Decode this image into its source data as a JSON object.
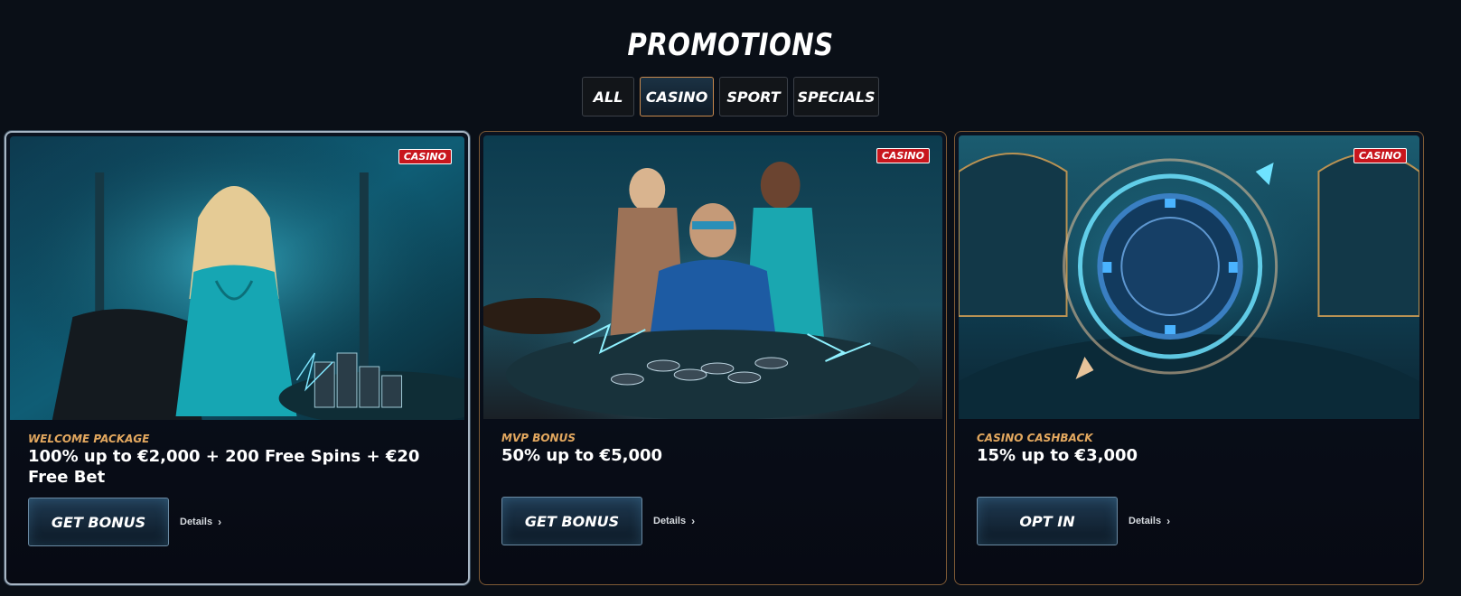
{
  "page": {
    "title": "PROMOTIONS"
  },
  "tabs": [
    {
      "label": "ALL",
      "active": false
    },
    {
      "label": "CASINO",
      "active": true
    },
    {
      "label": "SPORT",
      "active": false
    },
    {
      "label": "SPECIALS",
      "active": false
    }
  ],
  "cards": [
    {
      "badge": "CASINO",
      "kicker": "WELCOME PACKAGE",
      "offer": "100% up to €2,000 + 200 Free Spins + €20 Free Bet",
      "cta": "GET BONUS",
      "details": "Details",
      "image": "woman-at-casino-table-illustration"
    },
    {
      "badge": "CASINO",
      "kicker": "MVP BONUS",
      "offer": "50% up to €5,000",
      "cta": "GET BONUS",
      "details": "Details",
      "image": "vip-players-with-chips-illustration"
    },
    {
      "badge": "CASINO",
      "kicker": "CASINO CASHBACK",
      "offer": "15% up to €3,000",
      "cta": "OPT IN",
      "details": "Details",
      "image": "chip-with-circular-arrows-illustration"
    }
  ],
  "colors": {
    "accent": "#e3a85f",
    "badge": "#c8161d",
    "background": "#0a0f17"
  }
}
